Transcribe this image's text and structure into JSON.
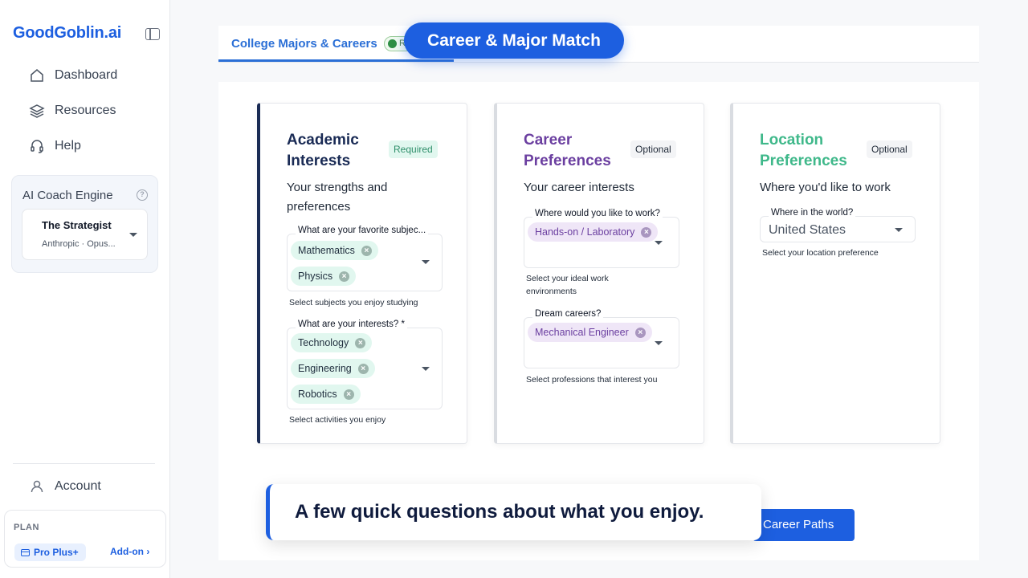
{
  "sidebar": {
    "brand": "GoodGoblin.ai",
    "nav": [
      {
        "label": "Dashboard",
        "icon": "home-icon"
      },
      {
        "label": "Resources",
        "icon": "layers-icon"
      },
      {
        "label": "Help",
        "icon": "headset-icon"
      }
    ],
    "coach": {
      "title": "AI Coach Engine",
      "name": "The Strategist",
      "sub": "Anthropic · Opus..."
    },
    "account": "Account",
    "plan": {
      "label": "PLAN",
      "tier": "Pro Plus+",
      "addon": "Add-on ›"
    }
  },
  "tabs": {
    "active": "College Majors & Careers",
    "badge": "R"
  },
  "overlay_title": "Career & Major Match",
  "cards": {
    "academic": {
      "title": "Academic Interests",
      "badge": "Required",
      "subtitle": "Your strengths and preferences",
      "subjects": {
        "label": "What are your favorite subjec...",
        "chips": [
          "Mathematics",
          "Physics"
        ],
        "help": "Select subjects you enjoy studying"
      },
      "interests": {
        "label": "What are your interests? *",
        "chips": [
          "Technology",
          "Engineering",
          "Robotics"
        ],
        "help": "Select activities you enjoy"
      }
    },
    "career": {
      "title": "Career Preferences",
      "badge": "Optional",
      "subtitle": "Your career interests",
      "work": {
        "label": "Where would you like to work?",
        "chips": [
          "Hands-on / Laboratory"
        ],
        "help": "Select your ideal work environments"
      },
      "dream": {
        "label": "Dream careers?",
        "chips": [
          "Mechanical Engineer"
        ],
        "help": "Select professions that interest you"
      }
    },
    "location": {
      "title": "Location Preferences",
      "badge": "Optional",
      "subtitle": "Where you'd like to work",
      "world": {
        "label": "Where in the world?",
        "value": "United States",
        "help": "Select your location preference"
      }
    }
  },
  "bottom_button": "Career Paths",
  "caption": "A few quick questions about what you enjoy.",
  "colors": {
    "brand": "#1d5fe0",
    "academic": "#1a2b55",
    "career": "#6b3fa0",
    "location": "#3fb88a"
  }
}
